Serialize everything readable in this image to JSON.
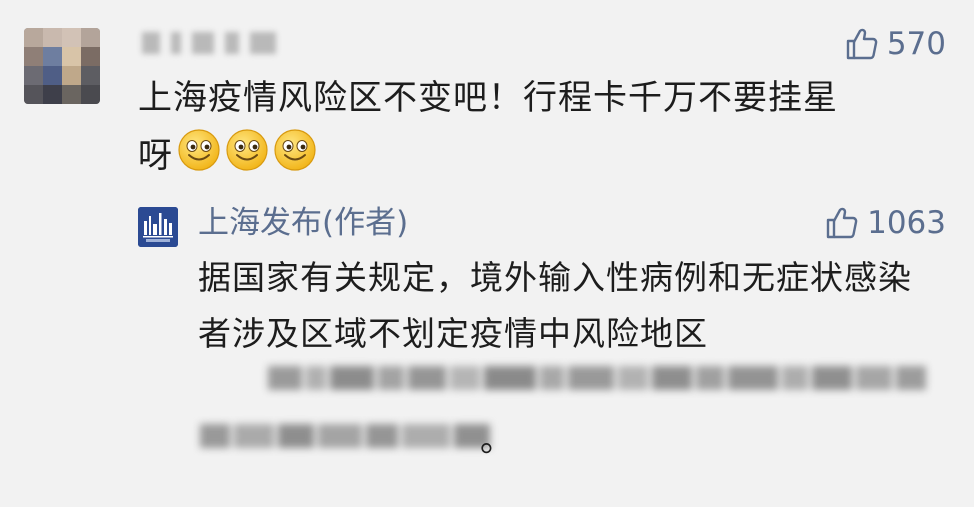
{
  "comment": {
    "likes": "570",
    "text": "上海疫情风险区不变吧！行程卡千万不要挂星",
    "text_tail": "呀",
    "emoji_icons": [
      "smile-emoji-icon",
      "smile-emoji-icon",
      "smile-emoji-icon"
    ]
  },
  "reply": {
    "author": "上海发布(作者)",
    "likes": "1063",
    "text": "据国家有关规定，境外输入性病例和无症状感染者涉及区域不划定疫情中风险地区",
    "text_end": "。"
  },
  "colors": {
    "background": "#f2f2f2",
    "link_blue": "#5b6e8f",
    "logo_blue": "#2b4a93",
    "emoji_yellow": "#f7c528"
  }
}
